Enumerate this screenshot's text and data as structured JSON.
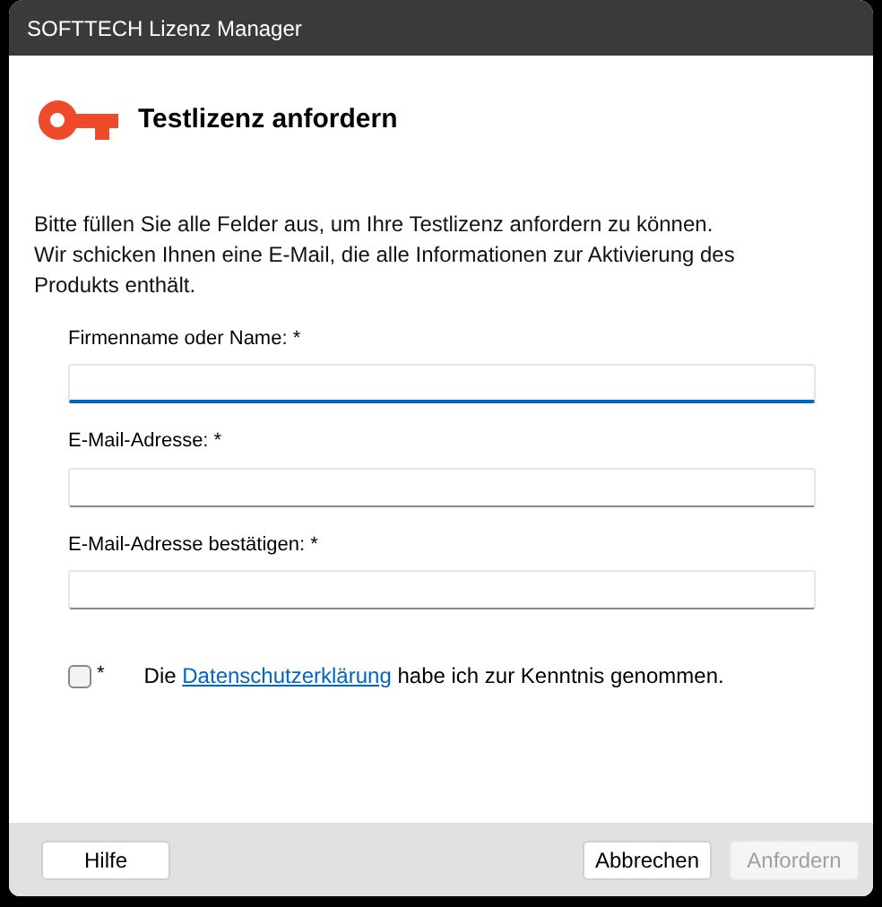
{
  "window": {
    "title": "SOFTTECH Lizenz Manager"
  },
  "heading": "Testlizenz anfordern",
  "intro": [
    "Bitte füllen Sie alle Felder aus, um Ihre Testlizenz anfordern zu können.",
    "Wir schicken Ihnen eine E-Mail, die alle Informationen zur Aktivierung des Produkts enthält."
  ],
  "fields": [
    {
      "label": "Firmenname oder Name: *",
      "focused": true
    },
    {
      "label": "E-Mail-Adresse: *",
      "focused": false
    },
    {
      "label": "E-Mail-Adresse bestätigen: *",
      "focused": false
    }
  ],
  "consent": {
    "checked": false,
    "marker": "*",
    "before": "Die",
    "link": "Datenschutzerklärung",
    "after": "habe ich zur Kenntnis genommen."
  },
  "buttons": [
    {
      "label": "Hilfe",
      "disabled": false
    },
    {
      "label": "Abbrechen",
      "disabled": false
    },
    {
      "label": "Anfordern",
      "disabled": true
    }
  ]
}
